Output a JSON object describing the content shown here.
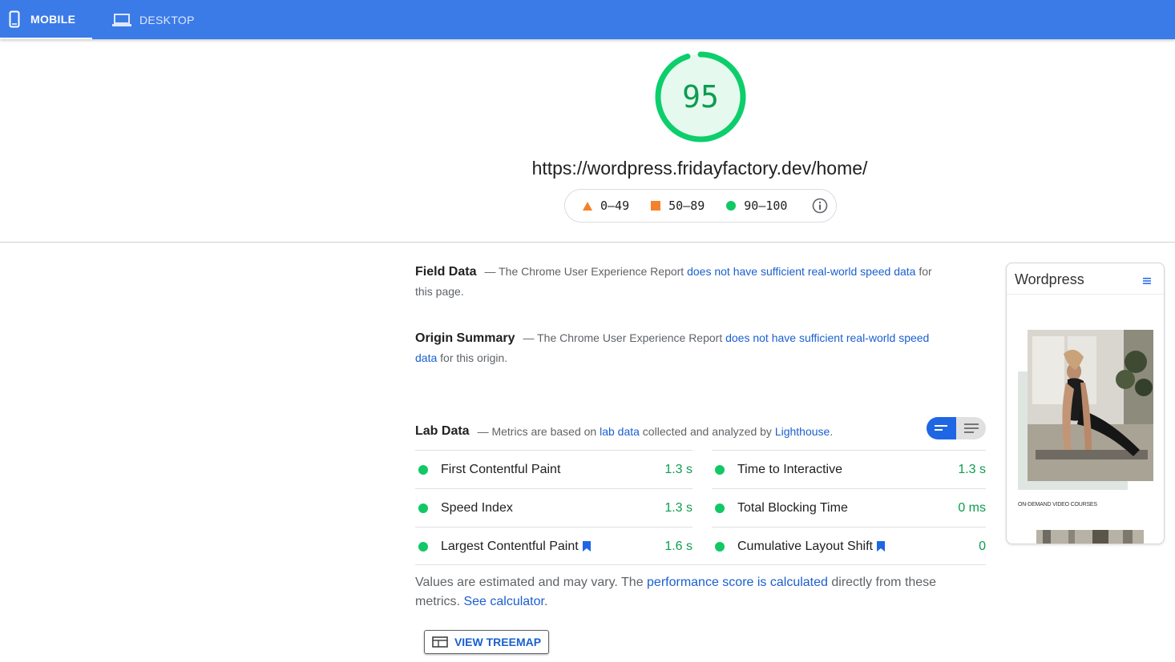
{
  "tabs": [
    {
      "label": "MOBILE",
      "icon": "phone-icon",
      "active": true
    },
    {
      "label": "DESKTOP",
      "icon": "laptop-icon",
      "active": false
    }
  ],
  "score": {
    "value": "95",
    "fraction": 0.95,
    "color": "#0cce6b"
  },
  "url": "https://wordpress.fridayfactory.dev/home/",
  "legend": {
    "fail": "0–49",
    "average": "50–89",
    "pass": "90–100",
    "icons": [
      "triangle-icon",
      "square-icon",
      "circle-icon",
      "info-icon"
    ]
  },
  "field_data": {
    "title": "Field Data",
    "prefix": "— The Chrome User Experience Report ",
    "link": "does not have sufficient real-world speed data",
    "suffix": " for this page."
  },
  "origin_summary": {
    "title": "Origin Summary",
    "prefix": "— The Chrome User Experience Report ",
    "link": "does not have sufficient real-world speed data",
    "suffix": " for this origin."
  },
  "lab_data": {
    "title": "Lab Data",
    "prefix": "— Metrics are based on ",
    "link1": "lab data",
    "middle": " collected and analyzed by ",
    "link2": "Lighthouse",
    "suffix": "."
  },
  "metrics": [
    {
      "name": "First Contentful Paint",
      "value": "1.3 s",
      "bookmark": false
    },
    {
      "name": "Time to Interactive",
      "value": "1.3 s",
      "bookmark": false
    },
    {
      "name": "Speed Index",
      "value": "1.3 s",
      "bookmark": false
    },
    {
      "name": "Total Blocking Time",
      "value": "0 ms",
      "bookmark": false
    },
    {
      "name": "Largest Contentful Paint",
      "value": "1.6 s",
      "bookmark": true
    },
    {
      "name": "Cumulative Layout Shift",
      "value": "0",
      "bookmark": true
    }
  ],
  "note": {
    "prefix": "Values are estimated and may vary. The ",
    "link1": "performance score is calculated",
    "middle": " directly from these metrics. ",
    "link2": "See calculator",
    "suffix": "."
  },
  "treemap_button": "VIEW TREEMAP",
  "thumbnail": {
    "title": "Wordpress",
    "caption": "ON-DEMAND VIDEO COURSES"
  },
  "colors": {
    "header": "#3b7be8",
    "pass": "#0cce6b",
    "average": "#ffa400",
    "link": "#1a5fd0"
  }
}
